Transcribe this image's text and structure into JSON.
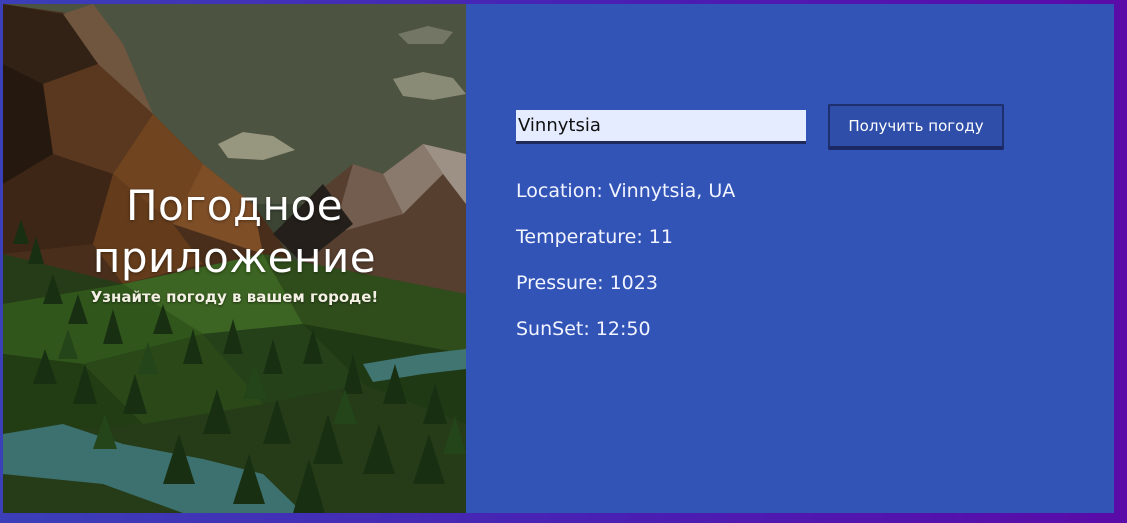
{
  "hero": {
    "title_line1": "Погодное",
    "title_line2": "приложение",
    "subtitle": "Узнайте погоду в вашем городе!"
  },
  "form": {
    "city_value": "Vinnytsia",
    "submit_label": "Получить погоду"
  },
  "results": {
    "location": "Location: Vinnytsia, UA",
    "temperature": "Temperature: 11",
    "pressure": "Pressure: 1023",
    "sunset": "SunSet: 12:50"
  },
  "colors": {
    "panel_bg": "#3254b7",
    "input_bg": "#e6ecff",
    "button_bg": "#2f4ea9",
    "frame_gradient_start": "#3b3fb8",
    "frame_gradient_end": "#5a0ba8"
  }
}
